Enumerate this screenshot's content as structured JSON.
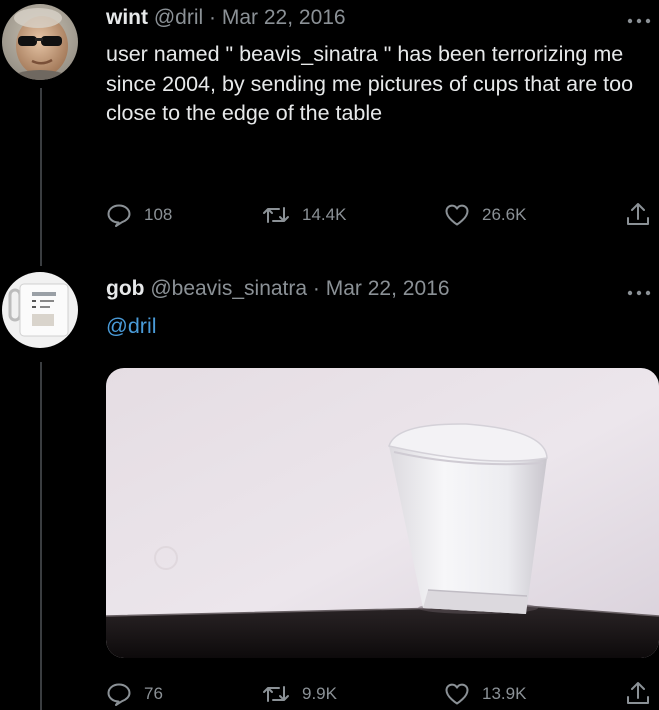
{
  "tweets": [
    {
      "display_name": "wint",
      "handle": "@dril",
      "separator": "·",
      "date": "Mar 22, 2016",
      "text": "user named \" beavis_sinatra \" has been terrorizing me since 2004, by sending me pictures of cups that are too close to the edge of the table",
      "replies": "108",
      "retweets": "14.4K",
      "likes": "26.6K",
      "avatar_icon": "person-sunglasses-avatar"
    },
    {
      "display_name": "gob",
      "handle": "@beavis_sinatra",
      "separator": "·",
      "date": "Mar 22, 2016",
      "text": "@dril",
      "replies": "76",
      "retweets": "9.9K",
      "likes": "13.9K",
      "avatar_icon": "mug-avatar",
      "media_icon": "styrofoam-cup-on-table-edge-photo"
    }
  ],
  "icons": {
    "reply": "reply-icon",
    "retweet": "retweet-icon",
    "like": "heart-icon",
    "share": "share-icon",
    "more": "more-icon"
  },
  "colors": {
    "background": "#000000",
    "text": "#e7e9ea",
    "muted": "#8b9196",
    "link": "#4a9bd8"
  }
}
